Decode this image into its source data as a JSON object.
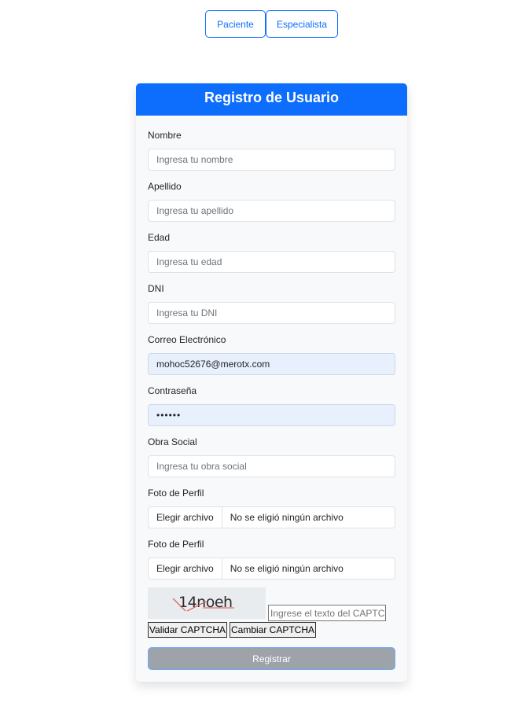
{
  "roles": {
    "paciente": "Paciente",
    "especialista": "Especialista"
  },
  "form": {
    "title": "Registro de Usuario",
    "nombre": {
      "label": "Nombre",
      "placeholder": "Ingresa tu nombre"
    },
    "apellido": {
      "label": "Apellido",
      "placeholder": "Ingresa tu apellido"
    },
    "edad": {
      "label": "Edad",
      "placeholder": "Ingresa tu edad"
    },
    "dni": {
      "label": "DNI",
      "placeholder": "Ingresa tu DNI"
    },
    "correo": {
      "label": "Correo Electrónico",
      "value": "mohoc52676@merotx.com"
    },
    "contrasena": {
      "label": "Contraseña",
      "value": "••••••"
    },
    "obra_social": {
      "label": "Obra Social",
      "placeholder": "Ingresa tu obra social"
    },
    "foto1": {
      "label": "Foto de Perfil",
      "button": "Elegir archivo",
      "status": "No se eligió ningún archivo"
    },
    "foto2": {
      "label": "Foto de Perfil",
      "button": "Elegir archivo",
      "status": "No se eligió ningún archivo"
    },
    "captcha": {
      "text": "14noeh",
      "placeholder": "Ingrese el texto del CAPTCHA",
      "validate_label": "Validar CAPTCHA",
      "change_label": "Cambiar CAPTCHA"
    },
    "submit_label": "Registrar"
  }
}
